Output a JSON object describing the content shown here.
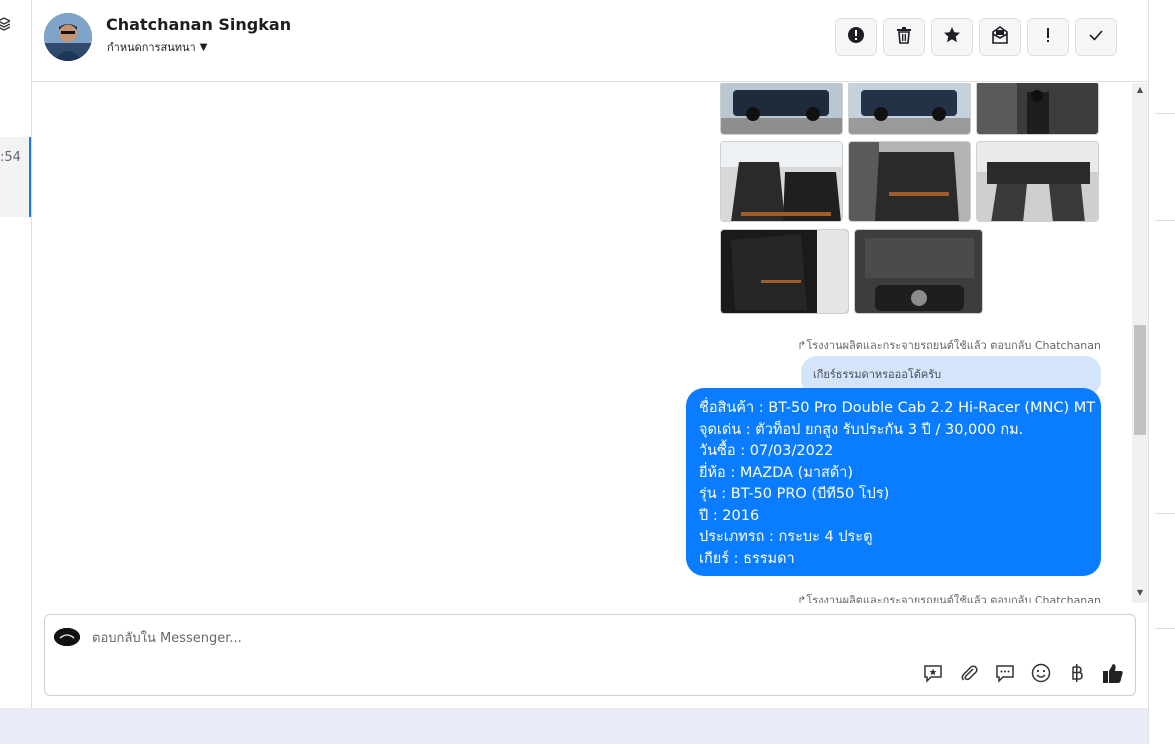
{
  "sidebar": {
    "time_fragment": ":54"
  },
  "header": {
    "contact_name": "Chatchanan Singkan",
    "assign_label": "กำหนดการสนทนา",
    "actions": [
      {
        "name": "spam-button",
        "icon": "alert-circle-icon"
      },
      {
        "name": "delete-button",
        "icon": "trash-icon"
      },
      {
        "name": "star-button",
        "icon": "star-icon"
      },
      {
        "name": "mark-unread-button",
        "icon": "envelope-icon"
      },
      {
        "name": "follow-up-button",
        "icon": "exclamation-icon"
      },
      {
        "name": "done-button",
        "icon": "check-icon"
      }
    ]
  },
  "conversation": {
    "reply_note_1": "↱โรงงานผลิตและกระจายรถยนต์ใช้แล้ว ตอบกลับ Chatchanan",
    "quoted_text": "เกียร์ธรรมดาหรอออโต้ครับ",
    "message_lines": [
      "ชื่อสินค้า : BT-50 Pro Double Cab 2.2 Hi-Racer (MNC) MT",
      "จุดเด่น : ตัวท็อป ยกสูง รับประกัน 3 ปี / 30,000 กม.",
      "วันซื้อ : 07/03/2022",
      "ยี่ห้อ : MAZDA (มาสด้า)",
      "รุ่น : BT-50 PRO (บีที50 โปร)",
      "ปี : 2016",
      "ประเภทรถ : กระบะ 4 ประตู",
      "เกียร์ : ธรรมดา"
    ],
    "reply_note_2": "↱โรงงานผลิตและกระจายรถยนต์ใช้แล้ว ตอบกลับ Chatchanan"
  },
  "composer": {
    "placeholder": "ตอบกลับใน Messenger...",
    "tools": [
      "saved-reply-icon",
      "attachment-icon",
      "chat-bubble-icon",
      "emoji-icon",
      "baht-icon",
      "thumbs-up-icon"
    ]
  }
}
